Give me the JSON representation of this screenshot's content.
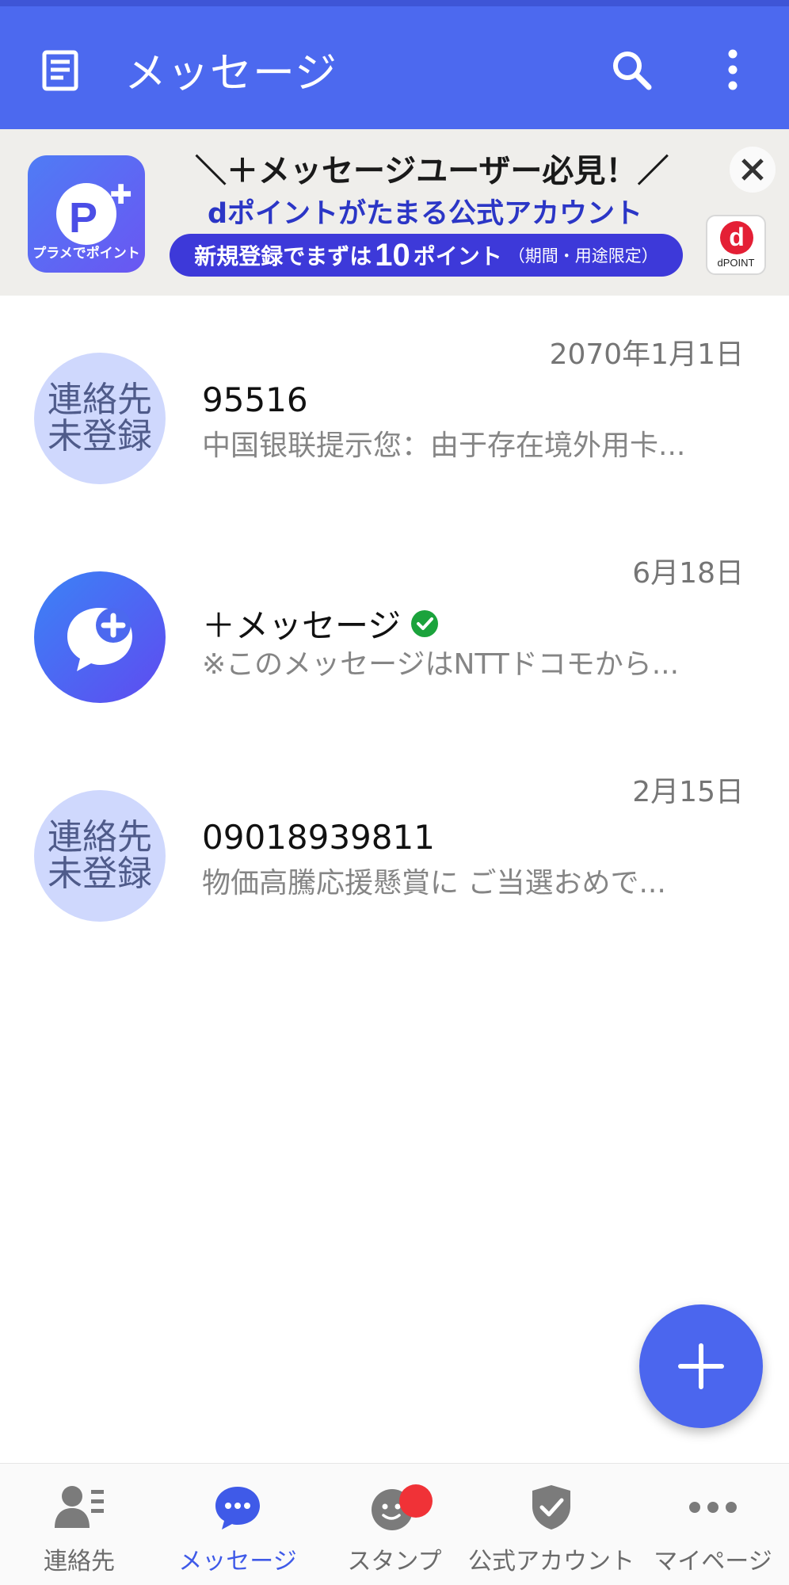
{
  "header": {
    "title": "メッセージ",
    "color": "#4c69ef",
    "icons": [
      "document-menu-icon",
      "search-icon",
      "more-vertical-icon"
    ]
  },
  "banner": {
    "logo_caption": "プラメでポイント",
    "line1": "＼＋メッセージユーザー必見！／",
    "line2": "dポイントがたまる公式アカウント",
    "pill_pre": "新規登録でまずは",
    "pill_num": "10",
    "pill_post": "ポイント",
    "pill_note": "（期間・用途限定）",
    "dpoint_label": "dPOINT",
    "close_icon": "close-icon"
  },
  "conversations": [
    {
      "avatar_line1": "連絡先",
      "avatar_line2": "未登録",
      "date": "2070年1月1日",
      "name": "95516",
      "preview": "中国银联提示您：由于存在境外用卡..."
    },
    {
      "avatar_icon": "plus-message-icon",
      "date": "6月18日",
      "name": "＋メッセージ",
      "verified": true,
      "preview": "※このメッセージはNTTドコモから..."
    },
    {
      "avatar_line1": "連絡先",
      "avatar_line2": "未登録",
      "date": "2月15日",
      "name": "09018939811",
      "preview": "物価高騰応援懸賞に ご当選おめで..."
    }
  ],
  "fab": {
    "icon": "plus-icon"
  },
  "bottom_nav": {
    "active": "メッセージ",
    "active_color": "#3f5ae8",
    "items": [
      {
        "label": "連絡先",
        "icon": "contacts-icon"
      },
      {
        "label": "メッセージ",
        "icon": "chat-bubble-icon"
      },
      {
        "label": "スタンプ",
        "icon": "sticker-icon",
        "badge": true
      },
      {
        "label": "公式アカウント",
        "icon": "shield-check-icon"
      },
      {
        "label": "マイページ",
        "icon": "more-horizontal-icon"
      }
    ]
  }
}
